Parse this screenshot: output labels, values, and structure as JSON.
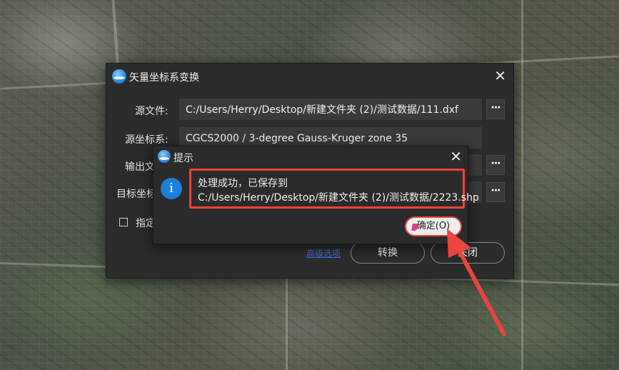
{
  "main_dialog": {
    "title": "矢量坐标系变换",
    "source_file_label": "源文件:",
    "source_file_value": "C:/Users/Herry/Desktop/新建文件夹 (2)/测试数据/111.dxf",
    "source_crs_label": "源坐标系:",
    "source_crs_value": "CGCS2000 / 3-degree Gauss-Kruger zone 35",
    "output_file_label": "输出文",
    "target_crs_label": "目标坐标",
    "specify_label": "指定",
    "browse_label": "···",
    "link_label": "高级选项",
    "convert_button": "转换",
    "close_button": "关闭",
    "close_icon": "✕"
  },
  "message_box": {
    "title": "提示",
    "close_icon": "✕",
    "info_glyph": "i",
    "line1": "处理成功，已保存到",
    "line2": "C:/Users/Herry/Desktop/新建文件夹 (2)/测试数据/2223.shp",
    "ok_button": "确定(O)"
  },
  "colors": {
    "accent_red": "#e8453c",
    "dialog_bg": "#2b2b2b",
    "info_blue": "#1f7fd6"
  }
}
